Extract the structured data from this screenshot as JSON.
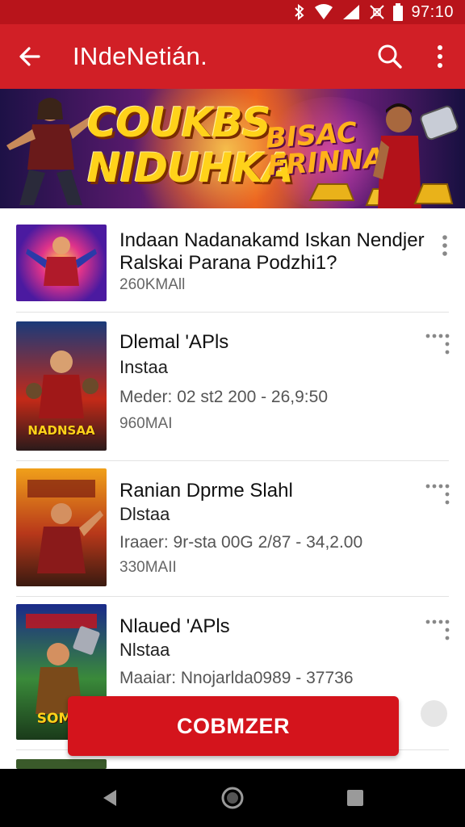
{
  "status_bar": {
    "time": "97:10"
  },
  "app_bar": {
    "title": "INdeNetián."
  },
  "banner": {
    "title_left": "COUKBS NIDUHKA",
    "title_right": "BISAC FRINNAS"
  },
  "items": [
    {
      "line1": "Indaan Nadanakamd Iskan Nendjer",
      "line2": "Ralskai Parana Podzhi1?",
      "size": "260KMAll"
    },
    {
      "line1": "Dlemal 'APls",
      "line2": "Instaa",
      "meta": "Meder: 02 st2 200 - 26,9:50",
      "size": "960MAI",
      "thumb_caption": "NADNSAA"
    },
    {
      "line1": "Ranian Dprme Slahl",
      "line2": "Dlstaa",
      "meta": "Iraaer: 9r-sta 00G 2/87 - 34,2.00",
      "size": "330MAII"
    },
    {
      "line1": "Nlaued 'APls",
      "line2": "Nlstaa",
      "meta": "Maaiar: Nnojarlda0989 - 37736",
      "thumb_caption": "SOMM"
    }
  ],
  "cta": {
    "label": "COBMZER"
  },
  "colors": {
    "primary": "#d11f26",
    "status_bar": "#b8141b",
    "cta": "#d4141c"
  },
  "icons": {
    "back": "arrow-back-icon",
    "search": "search-icon",
    "menu": "overflow-menu-icon",
    "more": "more-dots-icon"
  }
}
